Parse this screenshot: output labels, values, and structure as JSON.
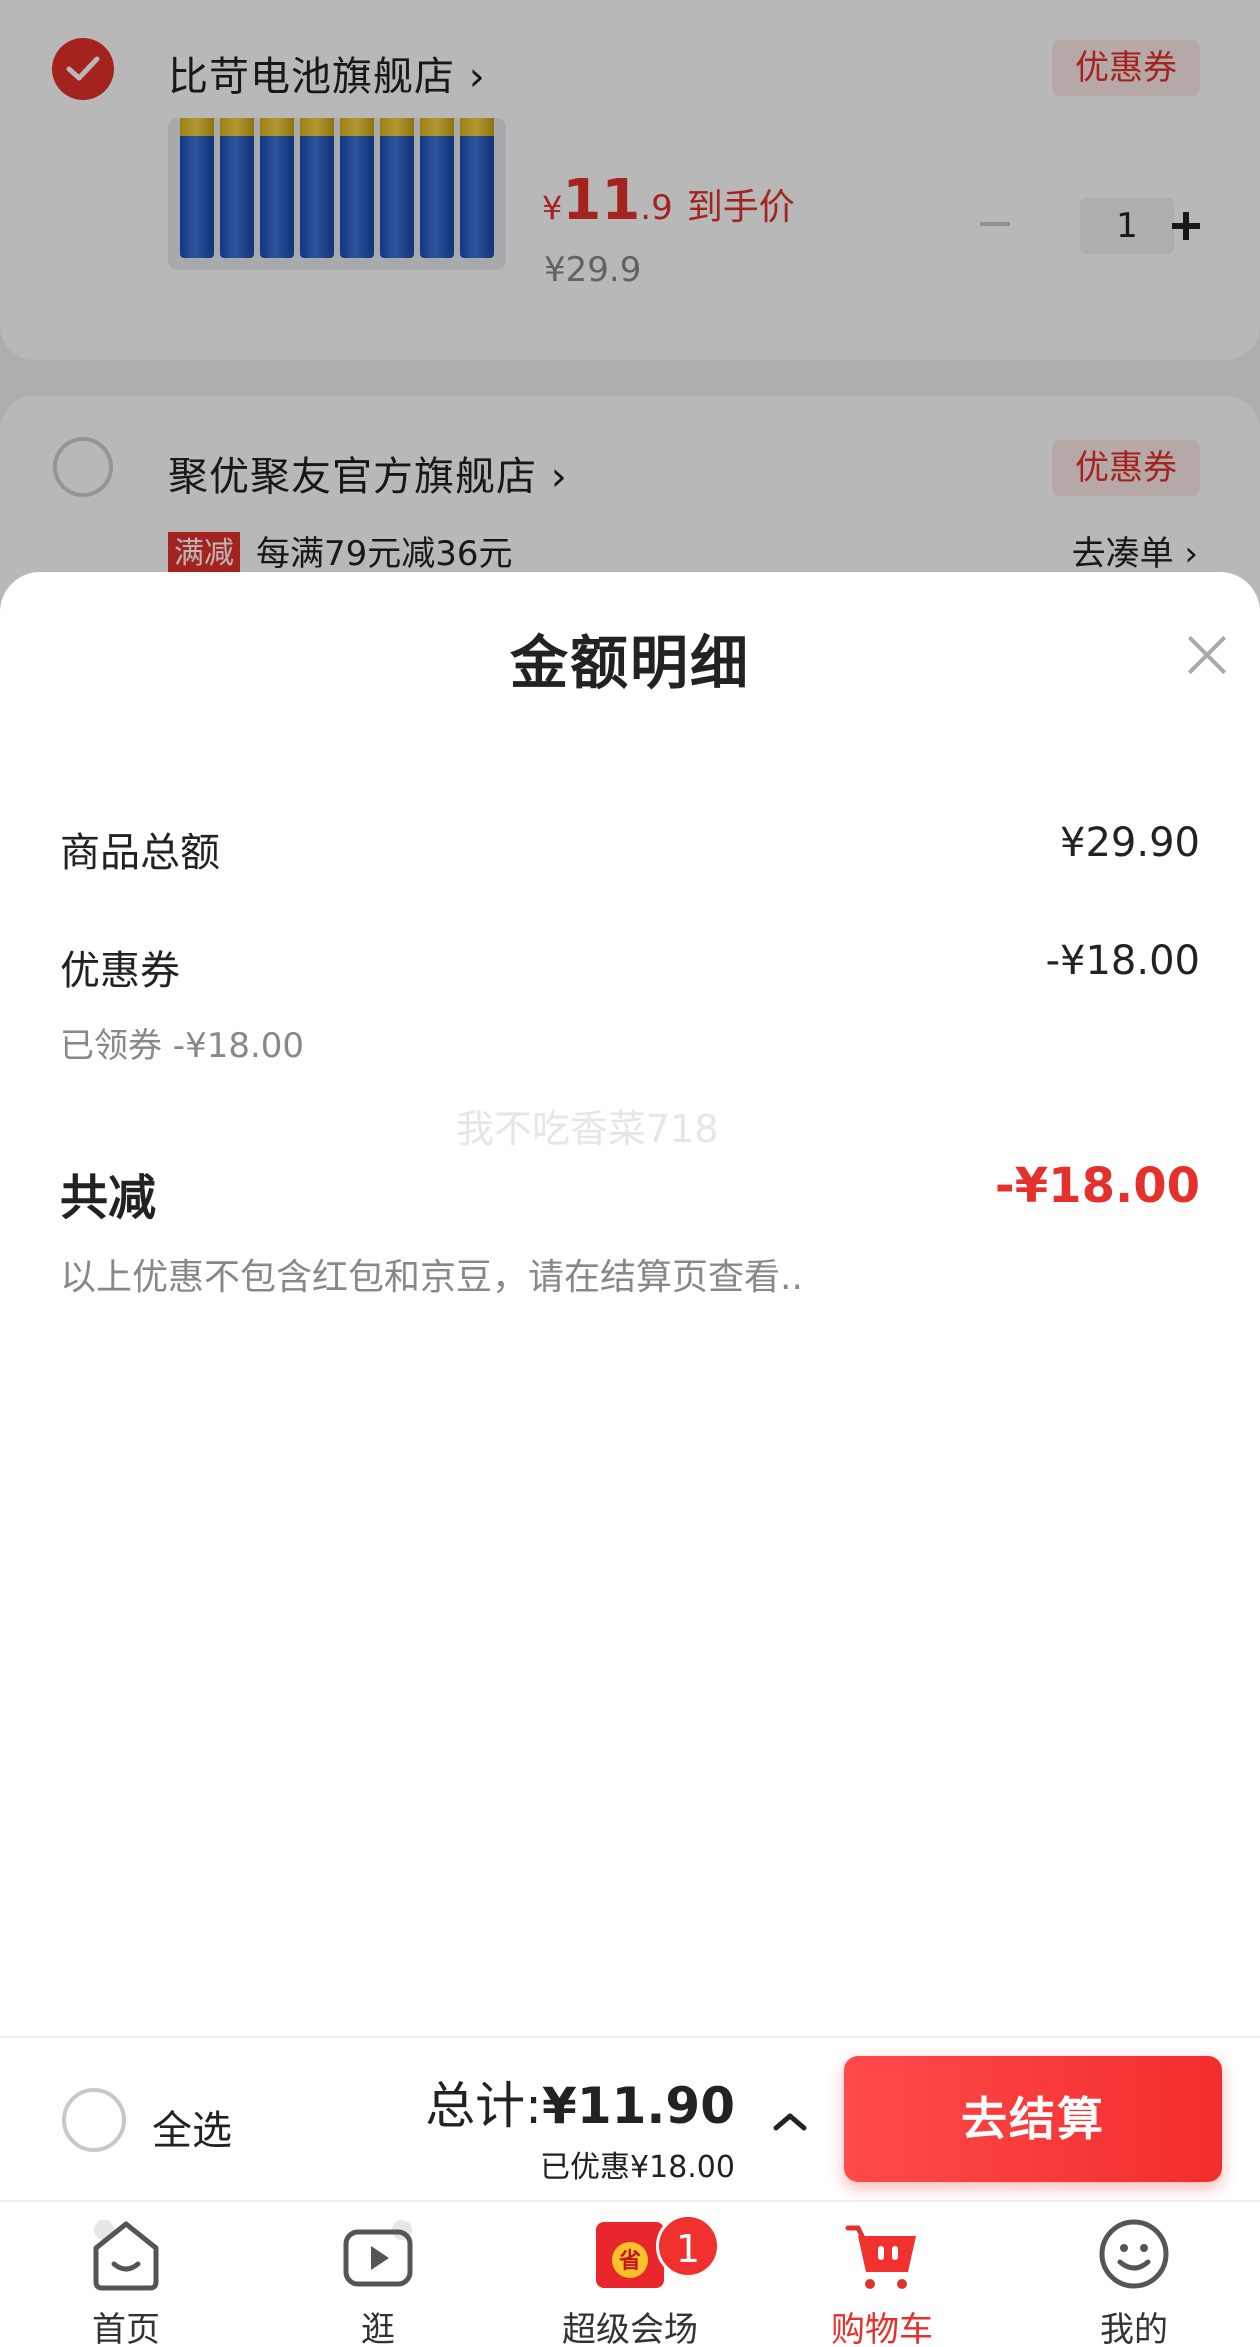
{
  "cart": {
    "store1": {
      "name": "比苛电池旗舰店 ›",
      "coupon_label": "优惠券",
      "product": {
        "price_currency": "¥",
        "price_int": "11",
        "price_dec": ".9",
        "price_tag": "到手价",
        "original_price": "¥29.9",
        "quantity": "1"
      }
    },
    "store2": {
      "name": "聚优聚友官方旗舰店 ›",
      "coupon_label": "优惠券",
      "promo_badge": "满减",
      "promo_text": "每满79元减36元",
      "promo_link": "去凑单 ›"
    }
  },
  "detail": {
    "title": "金额明细",
    "rows": [
      {
        "label": "商品总额",
        "value": "¥29.90"
      },
      {
        "label": "优惠券",
        "value": "-¥18.00"
      }
    ],
    "coupon_note": "已领券 -¥18.00",
    "watermark": "我不吃香菜718",
    "total_label": "共减",
    "total_value": "-¥18.00",
    "footnote": "以上优惠不包含红包和京豆，请在结算页查看.."
  },
  "checkout": {
    "select_all": "全选",
    "total_prefix": "总计:",
    "total_amount": "¥11.90",
    "discount": "已优惠¥18.00",
    "button": "去结算"
  },
  "tabs": [
    {
      "label": "首页",
      "icon": "home-icon"
    },
    {
      "label": "逛",
      "icon": "video-icon"
    },
    {
      "label": "超级会场",
      "icon": "super-venue-icon",
      "badge": "1"
    },
    {
      "label": "购物车",
      "icon": "cart-icon",
      "active": true
    },
    {
      "label": "我的",
      "icon": "profile-icon"
    }
  ],
  "colors": {
    "accent": "#e4312b",
    "checkout_button": "#f22d2d"
  }
}
